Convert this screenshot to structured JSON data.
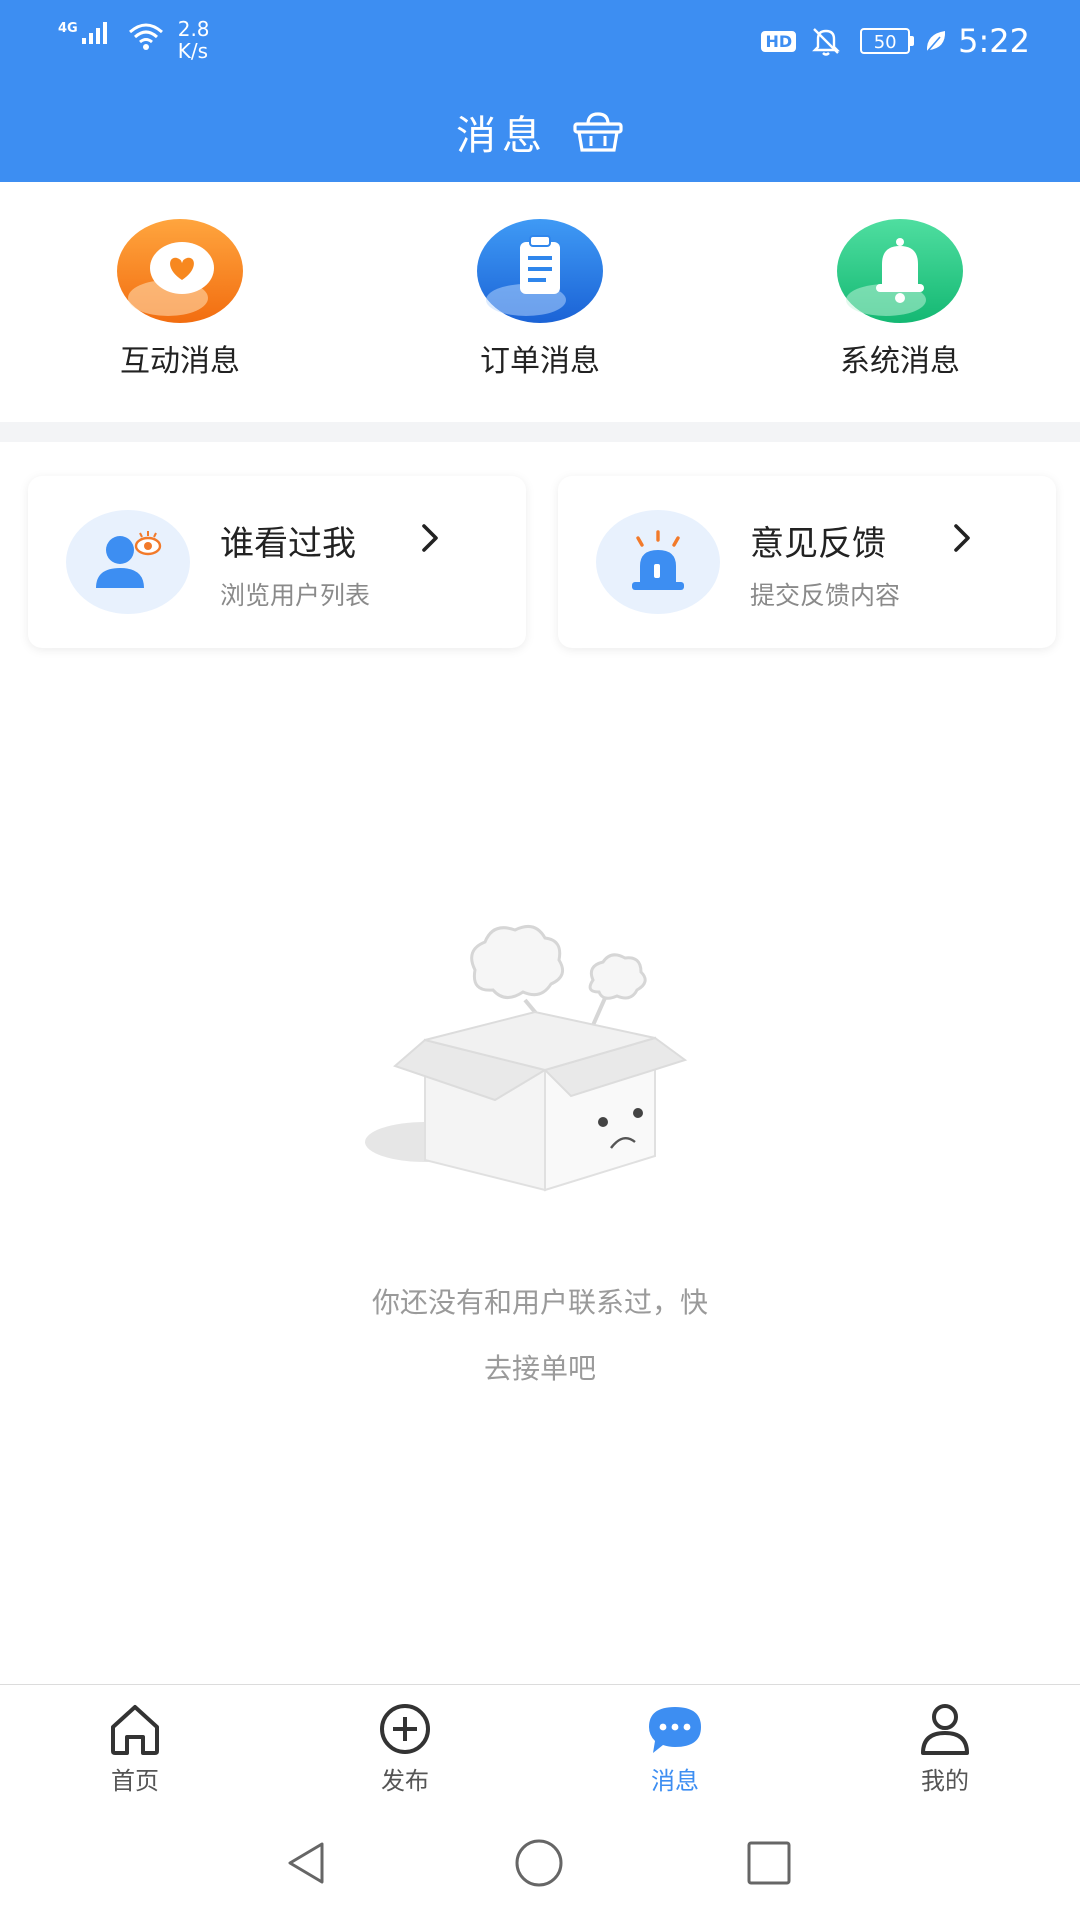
{
  "status_bar": {
    "network": "4G",
    "speed_value": "2.8",
    "speed_unit": "K/s",
    "hd": "HD",
    "battery": "50",
    "time": "5:22"
  },
  "header": {
    "title": "消息"
  },
  "categories": [
    {
      "label": "互动消息",
      "icon": "heart-chat-icon",
      "color": "#f7881f"
    },
    {
      "label": "订单消息",
      "icon": "clipboard-icon",
      "color": "#2f86ec"
    },
    {
      "label": "系统消息",
      "icon": "bell-icon",
      "color": "#2fcf8a"
    }
  ],
  "cards": [
    {
      "title": "谁看过我",
      "subtitle": "浏览用户列表",
      "icon": "user-eye-icon"
    },
    {
      "title": "意见反馈",
      "subtitle": "提交反馈内容",
      "icon": "alarm-light-icon"
    }
  ],
  "empty_state": {
    "line1": "你还没有和用户联系过，快",
    "line2": "去接单吧",
    "icon": "empty-box-icon"
  },
  "bottom_nav": [
    {
      "label": "首页",
      "icon": "home-icon",
      "active": false
    },
    {
      "label": "发布",
      "icon": "plus-circle-icon",
      "active": false
    },
    {
      "label": "消息",
      "icon": "chat-bubble-icon",
      "active": true
    },
    {
      "label": "我的",
      "icon": "user-icon",
      "active": false
    }
  ],
  "colors": {
    "header": "#3d8ef2",
    "active": "#3d8ef2"
  }
}
